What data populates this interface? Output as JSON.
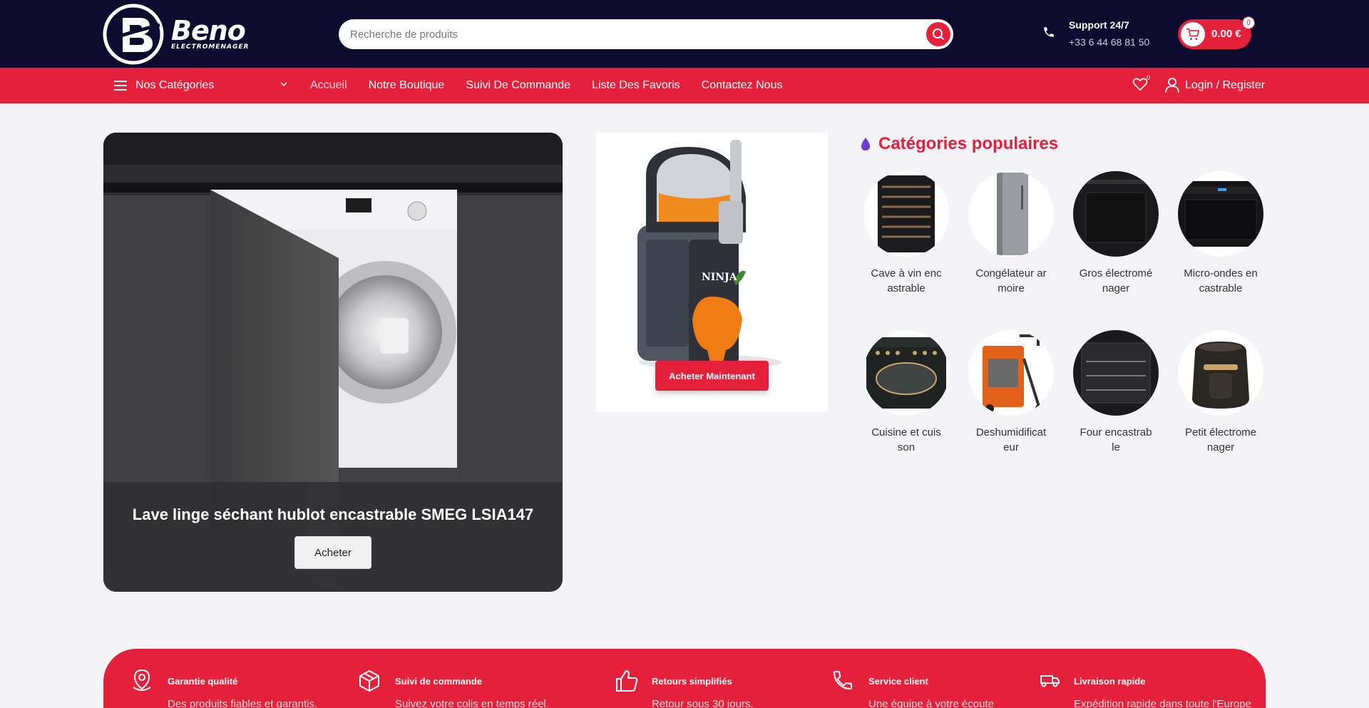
{
  "brand": {
    "name": "Beno",
    "tagline": "ELECTROMENAGER"
  },
  "search": {
    "placeholder": "Recherche de produits"
  },
  "support": {
    "label": "Support 24/7",
    "phone": "+33 6 44 68 81 50"
  },
  "cart": {
    "amount": "0.00 €",
    "count": "0"
  },
  "nav": {
    "categories_label": "Nos Catégories",
    "links": [
      "Accueil",
      "Notre Boutique",
      "Suivi De Commande",
      "Liste Des Favoris",
      "Contactez Nous"
    ],
    "wishlist_count": "0",
    "login_label": "Login / Register"
  },
  "hero": {
    "title": "Lave linge séchant hublot encastrable SMEG LSIA147",
    "button": "Acheter"
  },
  "promo": {
    "button": "Acheter Maintenant",
    "brand_mark": "NINJA"
  },
  "popular": {
    "title": "Catégories populaires",
    "items": [
      {
        "name": "Cave à vin encastrable",
        "icon": "wine-cellar"
      },
      {
        "name": "Congélateur armoire",
        "icon": "freezer"
      },
      {
        "name": "Gros électroménager",
        "icon": "large-appliance"
      },
      {
        "name": "Micro-ondes encastrable",
        "icon": "microwave"
      },
      {
        "name": "Cuisine et cuisson",
        "icon": "range-cooker"
      },
      {
        "name": "Deshumidificateur",
        "icon": "dehumidifier"
      },
      {
        "name": "Four encastrable",
        "icon": "oven"
      },
      {
        "name": "Petit électromenager",
        "icon": "air-fryer"
      }
    ]
  },
  "features": [
    {
      "title": "Garantie qualité",
      "desc": "Des produits fiables et garantis.",
      "icon": "location-badge-icon"
    },
    {
      "title": "Suivi de commande",
      "desc": "Suivez votre colis en temps réel.",
      "icon": "box-icon"
    },
    {
      "title": "Retours simplifiés",
      "desc": "Retour sous 30 jours.",
      "icon": "thumbs-up-icon"
    },
    {
      "title": "Service client",
      "desc": "Une équipe à votre écoute",
      "icon": "phone-icon"
    },
    {
      "title": "Livraison rapide",
      "desc": "Expédition rapide dans toute l'Europe",
      "icon": "delivery-icon"
    }
  ],
  "colors": {
    "header": "#0d0b2e",
    "accent": "#e4203a",
    "background": "#f4f4f6"
  }
}
